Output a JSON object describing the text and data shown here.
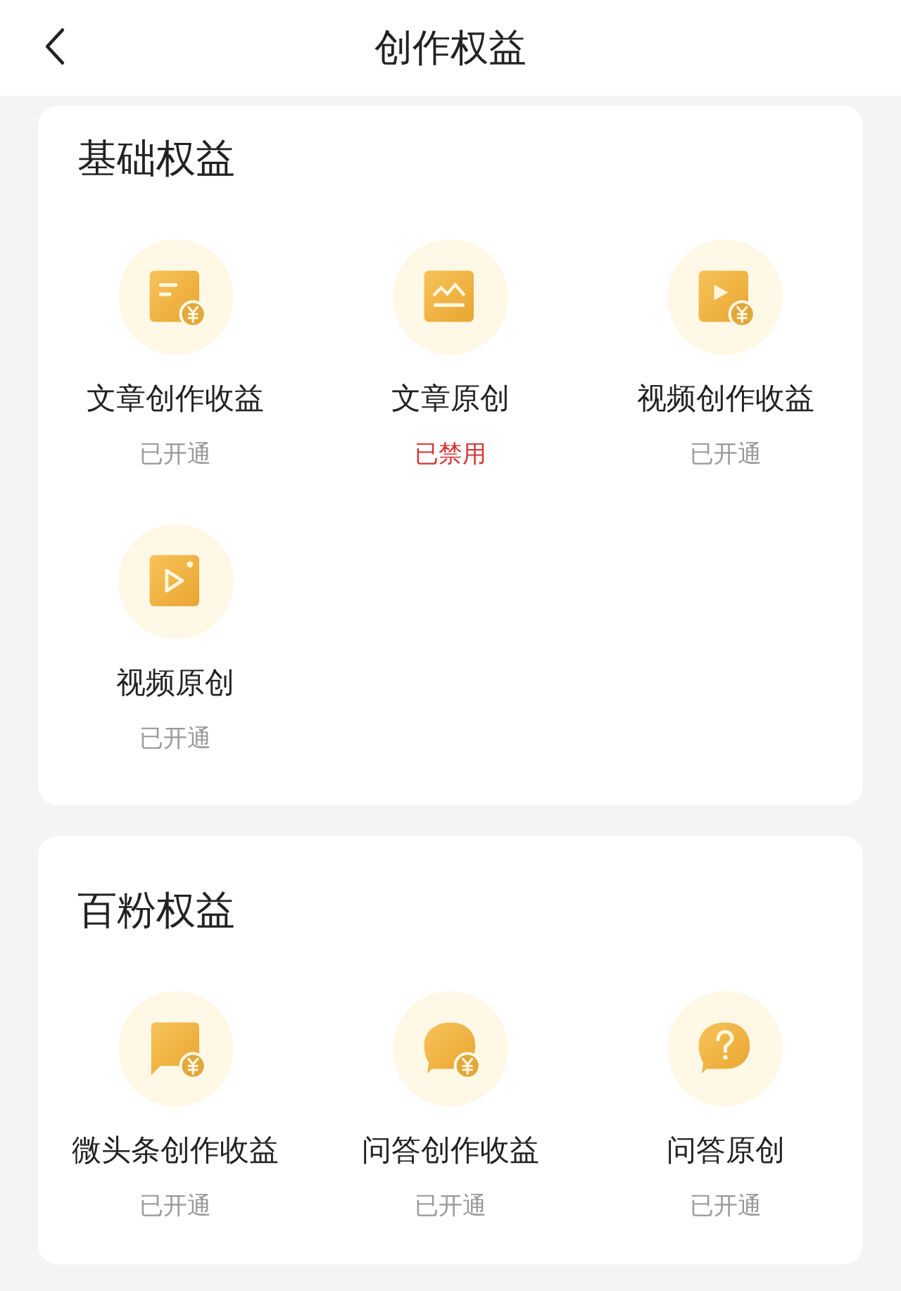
{
  "header": {
    "title": "创作权益"
  },
  "sections": [
    {
      "title": "基础权益",
      "items": [
        {
          "kind": "article-income",
          "label": "文章创作收益",
          "status": "已开通",
          "enabled": true
        },
        {
          "kind": "article-original",
          "label": "文章原创",
          "status": "已禁用",
          "enabled": false
        },
        {
          "kind": "video-income",
          "label": "视频创作收益",
          "status": "已开通",
          "enabled": true
        },
        {
          "kind": "video-original",
          "label": "视频原创",
          "status": "已开通",
          "enabled": true
        }
      ]
    },
    {
      "title": "百粉权益",
      "items": [
        {
          "kind": "post-income",
          "label": "微头条创作收益",
          "status": "已开通",
          "enabled": true
        },
        {
          "kind": "qa-income",
          "label": "问答创作收益",
          "status": "已开通",
          "enabled": true
        },
        {
          "kind": "qa-original",
          "label": "问答原创",
          "status": "已开通",
          "enabled": true
        }
      ]
    }
  ]
}
